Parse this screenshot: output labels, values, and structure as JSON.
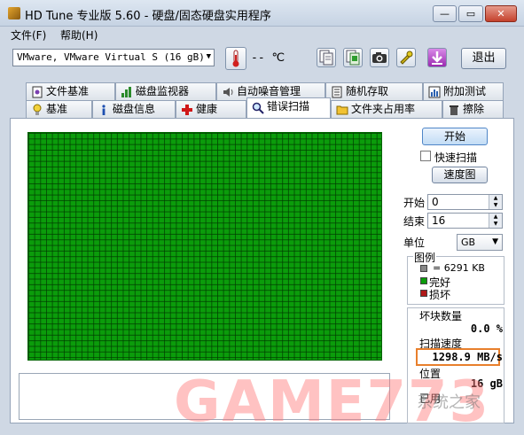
{
  "window": {
    "title": "HD Tune 专业版 5.60 - 硬盘/固态硬盘实用程序",
    "minimize": "—",
    "maximize": "▭",
    "close": "✕"
  },
  "menu": [
    "文件(F)",
    "帮助(H)"
  ],
  "toolbar": {
    "drive": "VMware, VMware Virtual S (16 gB)",
    "temperature": "-- ℃",
    "exit_label": "退出",
    "icons": [
      "copy-info-icon",
      "copy-screen-icon",
      "camera-icon",
      "options-icon",
      "save-icon"
    ]
  },
  "tabs_row1": [
    "文件基准",
    "磁盘监视器",
    "自动噪音管理",
    "随机存取",
    "附加测试"
  ],
  "tabs_row2": [
    "基准",
    "磁盘信息",
    "健康",
    "错误扫描",
    "文件夹占用率",
    "擦除"
  ],
  "active_tab": "错误扫描",
  "scan": {
    "start_button": "开始",
    "quick_scan_label": "快速扫描",
    "quick_scan_checked": false,
    "speed_map_button": "速度图",
    "start_label": "开始",
    "start_value": "0",
    "end_label": "结束",
    "end_value": "16",
    "unit_label": "单位",
    "unit_value": "GB",
    "legend_title": "图例",
    "legend_block": "= 6291 KB",
    "legend_ok": "完好",
    "legend_bad": "损坏",
    "bad_blocks_label": "坏块数量",
    "bad_blocks_value": "0.0 %",
    "scan_speed_label": "扫描速度",
    "scan_speed_value": "1298.9 MB/s",
    "position_label": "位置",
    "position_value": "16 gB",
    "elapsed_label": "已用"
  },
  "colors": {
    "block_ok": "#0b9c0b",
    "block_bad": "#b01818",
    "block_unscanned": "#888888",
    "highlight": "#e87f2c"
  },
  "watermark": {
    "text": "GAME773",
    "sub": "系统之家"
  }
}
